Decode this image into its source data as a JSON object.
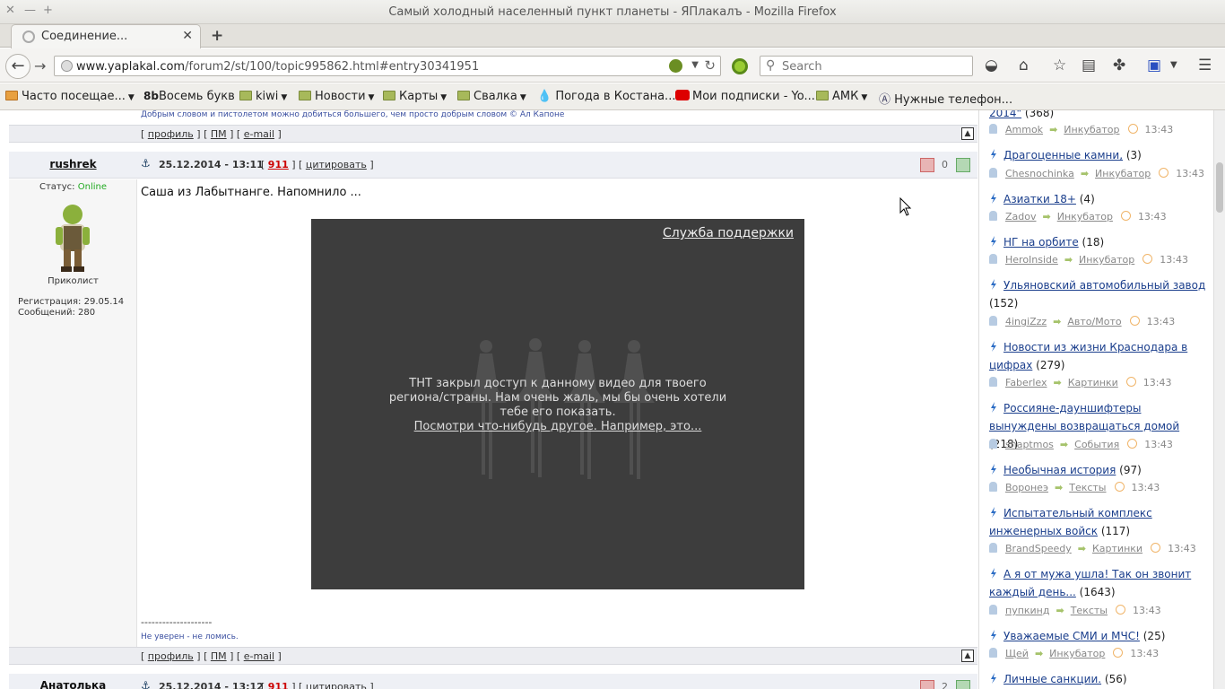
{
  "window": {
    "title": "Самый холодный населенный пункт планеты - ЯПлакалъ - Mozilla Firefox"
  },
  "tab": {
    "label": "Соединение...",
    "close": "✕",
    "new": "+"
  },
  "nav": {
    "url_domain": "www.yaplakal.com",
    "url_path": "/forum2/st/100/topic995862.html#entry30341951",
    "search_placeholder": "Search"
  },
  "bookmarks": [
    {
      "label": "Часто посещае..."
    },
    {
      "label": "Восемь букв"
    },
    {
      "label": "kiwi"
    },
    {
      "label": "Новости"
    },
    {
      "label": "Карты"
    },
    {
      "label": "Свалка"
    },
    {
      "label": "Погода в Костана..."
    },
    {
      "label": "Мои подписки - Yo..."
    },
    {
      "label": "АМК"
    },
    {
      "label": "Нужные телефон..."
    }
  ],
  "prev_post": {
    "signature": "Добрым словом и пистолетом можно добиться большего, чем просто добрым словом © Ал Капоне",
    "links": {
      "profile": "профиль",
      "pm": "ПМ",
      "email": "e-mail"
    }
  },
  "post": {
    "author": "rushrek",
    "date": "25.12.2014 - 13:11",
    "number": "911",
    "quote": "цитировать",
    "rating": "0",
    "status_label": "Статус:",
    "status_value": "Online",
    "rank": "Приколист",
    "registration": "Регистрация: 29.05.14",
    "messages": "Сообщений: 280",
    "text": "Саша из Лабытнанге. Напомнило ...",
    "video": {
      "support_link": "Служба поддержки",
      "message": "ТНТ закрыл доступ к данному видео для твоего региона/страны. Нам очень жаль, мы бы очень хотели тебе его показать.",
      "link": "Посмотри что-нибудь другое. Например, это..."
    },
    "sig_separator": "--------------------",
    "signature": "Не уверен - не ломись.",
    "links": {
      "profile": "профиль",
      "pm": "ПМ",
      "email": "e-mail"
    }
  },
  "next_post": {
    "author": "Анатолька",
    "date": "25.12.2014 - 13:12",
    "number": "911",
    "quote": "цитировать",
    "rating": "2"
  },
  "sidebar": [
    {
      "title": "2014\"",
      "count": "(368)",
      "user": "Ammok",
      "category": "Инкубатор",
      "time": "13:43"
    },
    {
      "title": "Драгоценные камни,",
      "count": "(3)",
      "user": "Chesnochinka",
      "category": "Инкубатор",
      "time": "13:43"
    },
    {
      "title": "Азиатки 18+",
      "count": "(4)",
      "user": "Zadov",
      "category": "Инкубатор",
      "time": "13:43"
    },
    {
      "title": "НГ на орбите",
      "count": "(18)",
      "user": "HeroInside",
      "category": "Инкубатор",
      "time": "13:43"
    },
    {
      "title": "Ульяновский автомобильный завод",
      "count": "(152)",
      "user": "4ingiZzz",
      "category": "Авто/Мото",
      "time": "13:43"
    },
    {
      "title": "Новости из жизни Краснодара в цифрах",
      "count": "(279)",
      "user": "Faberlex",
      "category": "Картинки",
      "time": "13:43"
    },
    {
      "title": "Россияне-дауншифтеры вынуждены возвращаться домой",
      "count": "(218)",
      "user": "shaptmos",
      "category": "События",
      "time": "13:43"
    },
    {
      "title": "Необычная история",
      "count": "(97)",
      "user": "Воронеэ",
      "category": "Тексты",
      "time": "13:43"
    },
    {
      "title": "Испытательный комплекс инженерных войск",
      "count": "(117)",
      "user": "BrandSpeedy",
      "category": "Картинки",
      "time": "13:43"
    },
    {
      "title": "А я от мужа ушла! Так он звонит каждый день...",
      "count": "(1643)",
      "user": "пупкинд",
      "category": "Тексты",
      "time": "13:43"
    },
    {
      "title": "Уважаемые СМИ и МЧС!",
      "count": "(25)",
      "user": "Щей",
      "category": "Инкубатор",
      "time": "13:43"
    },
    {
      "title": "Личные санкции.",
      "count": "(56)",
      "user": "",
      "category": "",
      "time": ""
    }
  ]
}
